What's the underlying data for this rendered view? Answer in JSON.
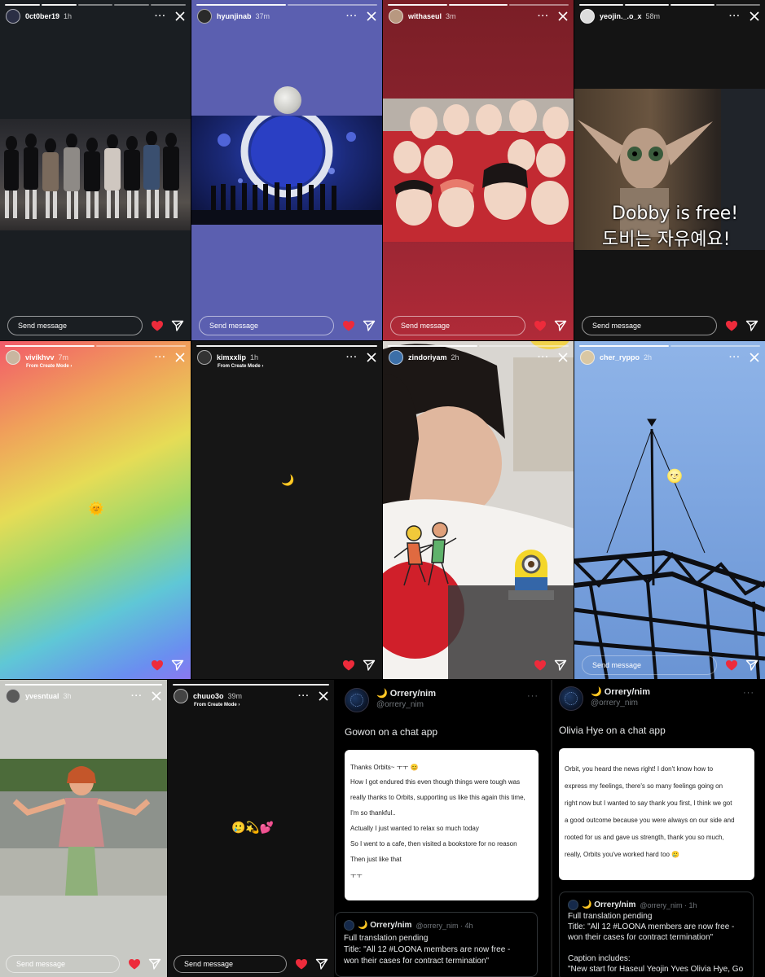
{
  "common": {
    "send_placeholder": "Send message",
    "more_glyph": "···",
    "from_create_mode": "From Create Mode ›"
  },
  "stories": [
    {
      "username": "0ct0ber19",
      "time": "1h"
    },
    {
      "username": "hyunjinab",
      "time": "37m"
    },
    {
      "username": "withaseul",
      "time": "3m"
    },
    {
      "username": "yeojin._.o_x",
      "time": "58m"
    },
    {
      "username": "vivikhvv",
      "time": "7m"
    },
    {
      "username": "kimxxlip",
      "time": "1h"
    },
    {
      "username": "zindoriyam",
      "time": "2h"
    },
    {
      "username": "cher_ryppo",
      "time": "2h"
    },
    {
      "username": "yvesntual",
      "time": "3h"
    },
    {
      "username": "chuuo3o",
      "time": "39m"
    }
  ],
  "stickers": {
    "dobby_en": "Dobby is free!",
    "dobby_ko": "도비는 자유예요!",
    "moon": "🌙",
    "sun_face": "🌞",
    "moon_face": "🌝",
    "emoji_row": "🥲💫💕"
  },
  "tweet_left": {
    "name": "🌙 Orrery/nim",
    "handle": "@orrery_nim",
    "text": "Gowon on a chat app",
    "chat_lines": [
      "Thanks Orbits~ ㅜㅜ 😊",
      "How I got endured this even though things were tough was",
      "really thanks to Orbits, supporting us like this again this time,",
      "I'm so thankful..",
      "Actually I just wanted to relax so much today",
      "So I went to a cafe, then visited a bookstore for no reason",
      "Then just like that",
      "ㅜㅜ"
    ],
    "quote": {
      "name": "🌙 Orrery/nim",
      "meta": "@orrery_nim · 4h",
      "lines": [
        "Full translation pending",
        "Title: \"All 12 #LOONA members are now free -",
        "won their cases for contract termination\""
      ]
    }
  },
  "tweet_right": {
    "name": "🌙 Orrery/nim",
    "handle": "@orrery_nim",
    "text": "Olivia Hye on a chat app",
    "chat_lines": [
      "Orbit, you heard the news right! I don't know how to",
      "express my feelings, there's so many feelings going on",
      "right now but I wanted to say thank you first, I think we got",
      "a good outcome because you were always on our side and",
      "rooted for us and gave us strength, thank you so much,",
      "really, Orbits you've worked hard too 🥲"
    ],
    "quote": {
      "name": "🌙 Orrery/nim",
      "meta": "@orrery_nim · 1h",
      "lines": [
        "Full translation pending",
        "Title: \"All 12 #LOONA members are now free -",
        "won their cases for contract termination\"",
        "",
        "Caption includes:",
        "\"New start for Haseul Yeojin Yves Olivia Hye, Go"
      ]
    }
  }
}
